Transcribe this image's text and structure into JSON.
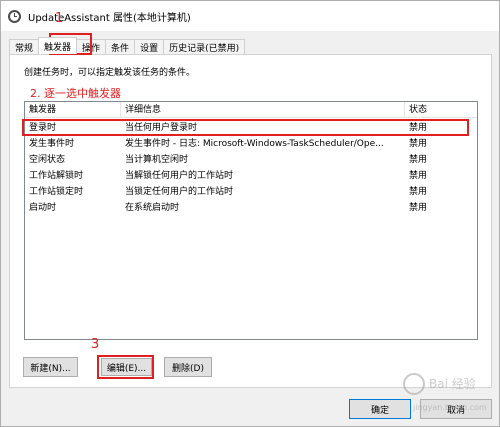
{
  "window": {
    "title": "UpdateAssistant 属性(本地计算机)"
  },
  "tabs": [
    {
      "label": "常规"
    },
    {
      "label": "触发器"
    },
    {
      "label": "操作"
    },
    {
      "label": "条件"
    },
    {
      "label": "设置"
    },
    {
      "label": "历史记录(已禁用)"
    }
  ],
  "active_tab": "触发器",
  "description": "创建任务时，可以指定触发该任务的条件。",
  "table": {
    "columns": [
      "触发器",
      "详细信息",
      "状态"
    ],
    "rows": [
      {
        "trigger": "登录时",
        "details": "当任何用户登录时",
        "status": "禁用",
        "selected": true
      },
      {
        "trigger": "发生事件时",
        "details": "发生事件时 - 日志: Microsoft-Windows-TaskScheduler/Ope...",
        "status": "禁用"
      },
      {
        "trigger": "空闲状态",
        "details": "当计算机空闲时",
        "status": "禁用"
      },
      {
        "trigger": "工作站解锁时",
        "details": "当解锁任何用户的工作站时",
        "status": "禁用"
      },
      {
        "trigger": "工作站锁定时",
        "details": "当锁定任何用户的工作站时",
        "status": "禁用"
      },
      {
        "trigger": "启动时",
        "details": "在系统启动时",
        "status": "禁用"
      }
    ]
  },
  "buttons": {
    "new": "新建(N)...",
    "edit": "编辑(E)...",
    "delete": "删除(D)",
    "ok": "确定",
    "cancel": "取消"
  },
  "annotations": {
    "step1": "1",
    "step2": "2. 逐一选中触发器",
    "step3": "3",
    "color": "#e02020"
  },
  "watermark": {
    "text": "Bai 经验",
    "url": "jingyan.baidu.com"
  }
}
